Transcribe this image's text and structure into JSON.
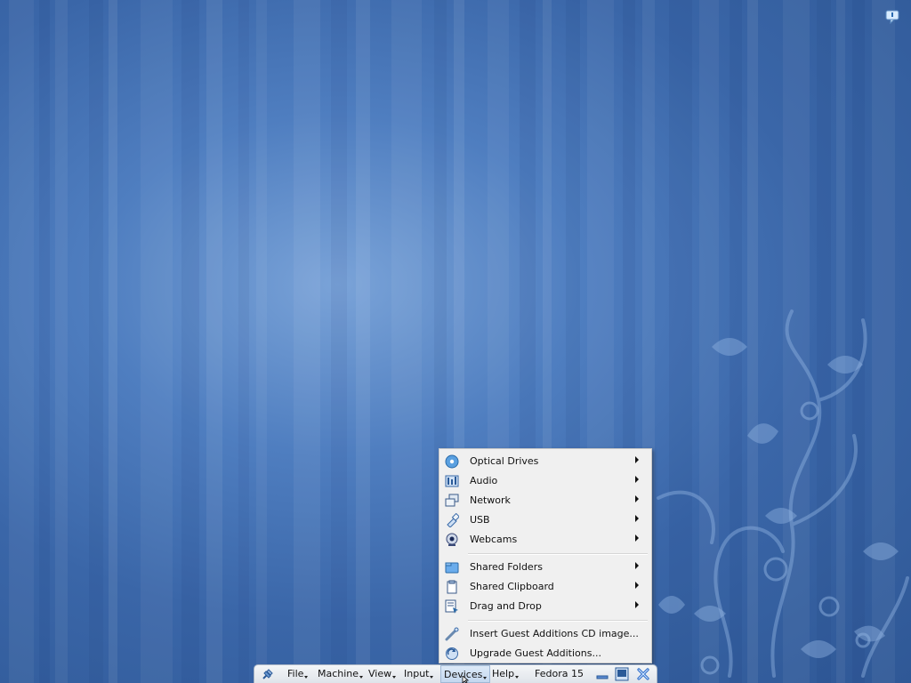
{
  "devices_menu": {
    "items": [
      {
        "label": "Optical Drives",
        "icon": "optical-drive-icon",
        "submenu": true
      },
      {
        "label": "Audio",
        "icon": "audio-icon",
        "submenu": true
      },
      {
        "label": "Network",
        "icon": "network-icon",
        "submenu": true
      },
      {
        "label": "USB",
        "icon": "usb-icon",
        "submenu": true
      },
      {
        "label": "Webcams",
        "icon": "webcam-icon",
        "submenu": true
      },
      {
        "label": "Shared Folders",
        "icon": "shared-folders-icon",
        "submenu": true
      },
      {
        "label": "Shared Clipboard",
        "icon": "shared-clipboard-icon",
        "submenu": true
      },
      {
        "label": "Drag and Drop",
        "icon": "drag-and-drop-icon",
        "submenu": true
      },
      {
        "label": "Insert Guest Additions CD image...",
        "icon": "guest-additions-cd-icon",
        "submenu": false
      },
      {
        "label": "Upgrade Guest Additions...",
        "icon": "upgrade-guest-additions-icon",
        "submenu": false
      }
    ]
  },
  "mini_toolbar": {
    "menus": {
      "file": "File",
      "machine": "Machine",
      "view": "View",
      "input": "Input",
      "devices": "Devices",
      "help": "Help"
    },
    "vm_name": "Fedora 15",
    "active_menu": "Devices"
  },
  "colors": {
    "desktop": "#3a66a8",
    "menu_background": "#f0f0f0",
    "toolbar_background": "#e8ecf0"
  }
}
